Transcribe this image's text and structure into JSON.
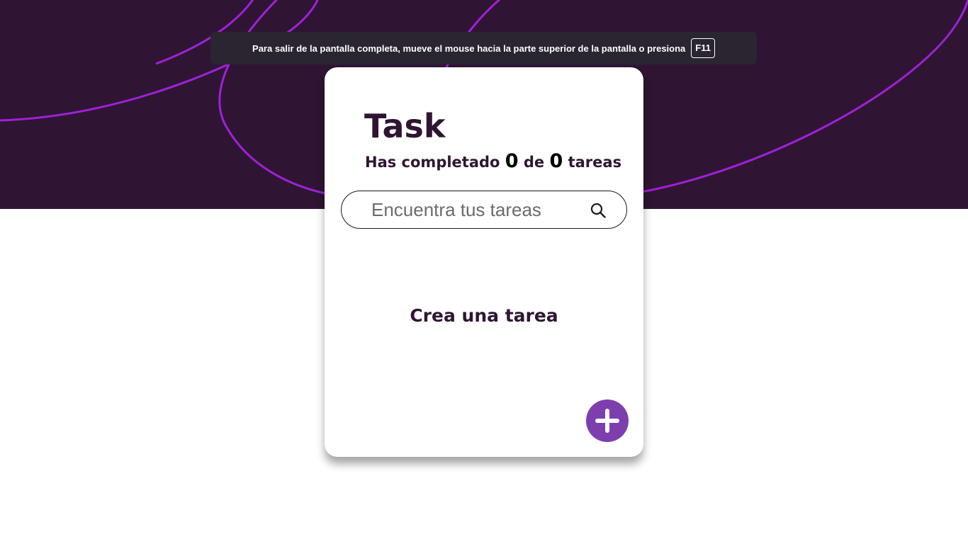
{
  "fullscreen_notice": {
    "message": "Para salir de la pantalla completa, mueve el mouse hacia la parte superior de la pantalla o presiona",
    "key": "F11"
  },
  "header": {
    "title": "Task",
    "counter": {
      "prefix": "Has completado",
      "completed": "0",
      "separator": "de",
      "total": "0",
      "suffix": "tareas"
    }
  },
  "search": {
    "placeholder": "Encuentra tus tareas",
    "value": "",
    "icon": "search-icon"
  },
  "empty_state": {
    "message": "Crea una tarea"
  },
  "add_button": {
    "icon": "plus-icon"
  },
  "colors": {
    "hero_background": "#2f1533",
    "accent": "#7e3fae",
    "hero_lines": "#a020d8",
    "text_dark": "#2f1533"
  }
}
